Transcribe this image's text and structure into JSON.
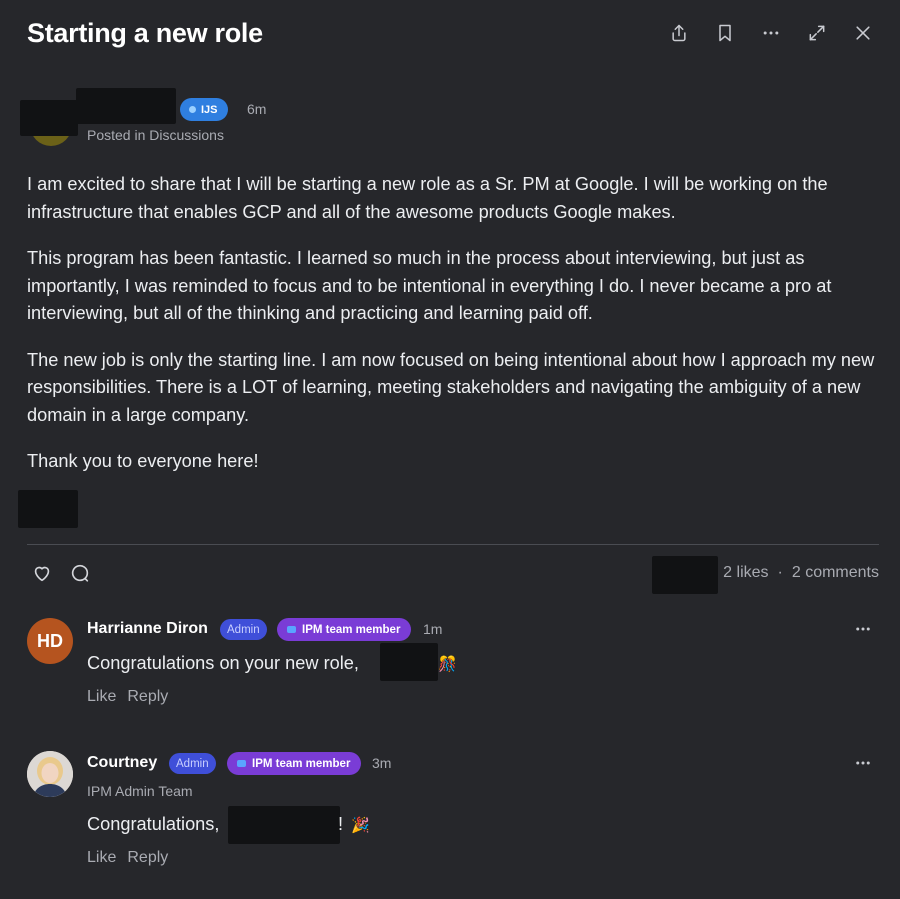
{
  "post": {
    "title": "Starting a new role",
    "time": "6m",
    "badge": "IJS",
    "posted_in": "Posted in Discussions",
    "paragraphs": [
      "I am excited to share that I will be starting a new role as a Sr. PM at Google. I will be working on the infrastructure that enables GCP and all of the awesome products Google makes.",
      "This program has been fantastic. I learned so much in the process about interviewing, but just as importantly, I was reminded to focus and to be intentional in everything I do. I never became a pro at interviewing, but all of the thinking and practicing and learning paid off.",
      "The new job is only the starting line. I am now focused on being intentional about how I approach my new responsibilities. There is a LOT of learning, meeting stakeholders and navigating the ambiguity of a new domain in a large company.",
      "Thank you to everyone here!"
    ],
    "likes": "2 likes",
    "separator": "·",
    "comments_count": "2 comments"
  },
  "header_icons": [
    "share-icon",
    "bookmark-icon",
    "more-icon",
    "expand-icon",
    "close-icon"
  ],
  "reaction_icons": [
    "heart-icon",
    "comment-icon"
  ],
  "comments": [
    {
      "initials": "HD",
      "name": "Harrianne Diron",
      "admin_tag": "Admin",
      "team_tag": "IPM team member",
      "time": "1m",
      "text": "Congratulations on your new role,",
      "emoji": "🎊",
      "like": "Like",
      "reply": "Reply"
    },
    {
      "name": "Courtney",
      "admin_tag": "Admin",
      "team_tag": "IPM team member",
      "time": "3m",
      "subtitle": "IPM Admin Team",
      "text": "Congratulations,",
      "suffix": "!",
      "emoji": "🎉",
      "like": "Like",
      "reply": "Reply"
    }
  ],
  "colors": {
    "background": "#26272b",
    "badge_blue": "#2f7fe0",
    "admin_tag": "#3f4fd9",
    "team_tag": "#7a3cd6",
    "avatar_hd": "#b5541f"
  }
}
